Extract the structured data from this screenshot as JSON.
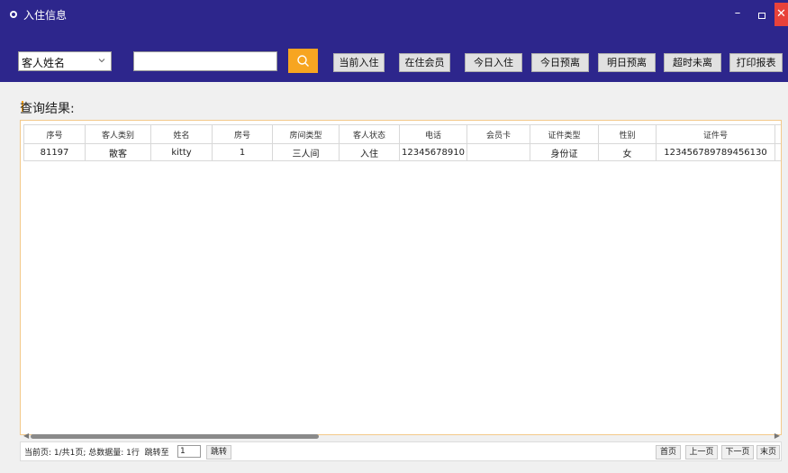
{
  "window": {
    "title": "入住信息",
    "minimize": "–",
    "close": "✕"
  },
  "toolbar": {
    "search_field": "客人姓名",
    "search_value": "",
    "buttons": [
      "当前入住",
      "在住会员",
      "今日入住",
      "今日预离",
      "明日预离",
      "超时未离",
      "打印报表"
    ]
  },
  "results": {
    "label": "查询结果:",
    "columns": [
      "序号",
      "客人类别",
      "姓名",
      "房号",
      "房间类型",
      "客人状态",
      "电话",
      "会员卡",
      "证件类型",
      "性别",
      "证件号"
    ],
    "rows": [
      [
        "81197",
        "散客",
        "kitty",
        "1",
        "三人间",
        "入住",
        "12345678910",
        "",
        "身份证",
        "女",
        "123456789789456130"
      ]
    ]
  },
  "pager": {
    "status_text": "当前页: 1/共1页; 总数据量: 1行",
    "jump_to_label": "跳转至",
    "jump_value": "1",
    "jump_button": "跳转",
    "first": "首页",
    "prev": "上一页",
    "next": "下一页",
    "last": "末页"
  },
  "colors": {
    "header_bg": "#2d268c",
    "accent": "#f7a521",
    "close_bg": "#e8423a"
  }
}
